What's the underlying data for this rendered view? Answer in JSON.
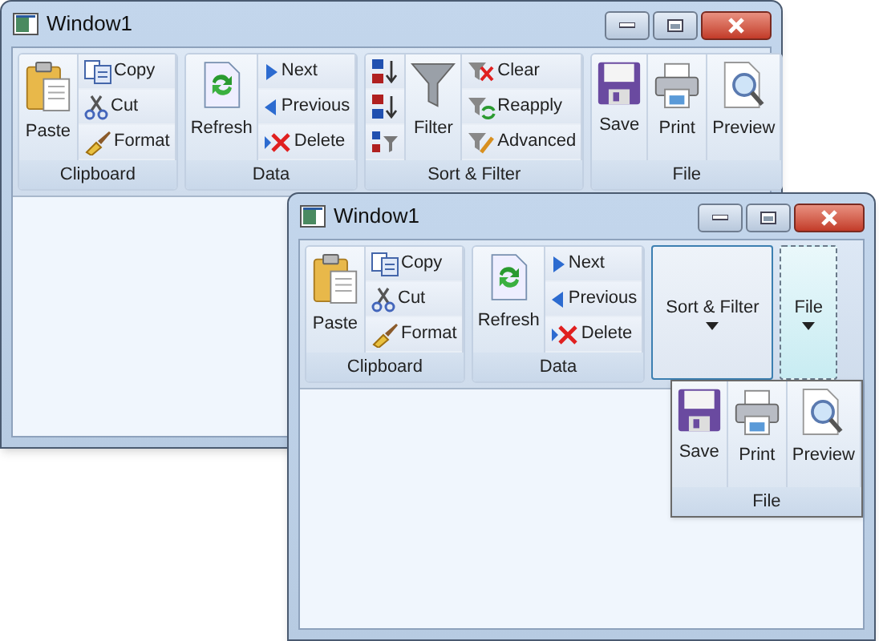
{
  "windows": [
    {
      "title": "Window1",
      "groups": [
        {
          "label": "Clipboard",
          "kind": "expanded",
          "columns": [
            {
              "kind": "large",
              "items": [
                {
                  "label": "Paste"
                }
              ]
            },
            {
              "kind": "small",
              "items": [
                {
                  "label": "Copy"
                },
                {
                  "label": "Cut"
                },
                {
                  "label": "Format"
                }
              ]
            }
          ]
        },
        {
          "label": "Data",
          "kind": "expanded",
          "columns": [
            {
              "kind": "large",
              "items": [
                {
                  "label": "Refresh"
                }
              ]
            },
            {
              "kind": "small",
              "items": [
                {
                  "label": "Next"
                },
                {
                  "label": "Previous"
                },
                {
                  "label": "Delete"
                }
              ]
            }
          ]
        },
        {
          "label": "Sort & Filter",
          "kind": "expanded",
          "columns": [
            {
              "kind": "small",
              "items": [
                {
                  "kind": "icon"
                },
                {
                  "kind": "icon"
                },
                {
                  "kind": "icon"
                }
              ]
            },
            {
              "kind": "large",
              "items": [
                {
                  "label": "Filter"
                }
              ]
            },
            {
              "kind": "small",
              "items": [
                {
                  "label": "Clear"
                },
                {
                  "label": "Reapply"
                },
                {
                  "label": "Advanced"
                }
              ]
            }
          ]
        },
        {
          "label": "File",
          "kind": "expanded",
          "columns": [
            {
              "kind": "large",
              "items": [
                {
                  "label": "Save"
                }
              ]
            },
            {
              "kind": "large",
              "items": [
                {
                  "label": "Print"
                }
              ]
            },
            {
              "kind": "large",
              "items": [
                {
                  "label": "Preview"
                }
              ]
            }
          ]
        }
      ]
    },
    {
      "title": "Window1",
      "groups": [
        {
          "label": "Clipboard",
          "kind": "expanded",
          "columns": [
            {
              "kind": "large",
              "items": [
                {
                  "label": "Paste"
                }
              ]
            },
            {
              "kind": "small",
              "items": [
                {
                  "label": "Copy"
                },
                {
                  "label": "Cut"
                },
                {
                  "label": "Format"
                }
              ]
            }
          ]
        },
        {
          "label": "Data",
          "kind": "expanded",
          "columns": [
            {
              "kind": "large",
              "items": [
                {
                  "label": "Refresh"
                }
              ]
            },
            {
              "kind": "small",
              "items": [
                {
                  "label": "Next"
                },
                {
                  "label": "Previous"
                },
                {
                  "label": "Delete"
                }
              ]
            }
          ]
        },
        {
          "label": "Sort & Filter",
          "kind": "collapsed",
          "selected": false,
          "hovered": true
        },
        {
          "label": "File",
          "kind": "collapsed",
          "selected": true,
          "hovered": false
        }
      ],
      "popup": {
        "label": "File",
        "columns": [
          {
            "kind": "large",
            "items": [
              {
                "label": "Save"
              }
            ]
          },
          {
            "kind": "large",
            "items": [
              {
                "label": "Print"
              }
            ]
          },
          {
            "kind": "large",
            "items": [
              {
                "label": "Preview"
              }
            ]
          }
        ]
      }
    }
  ]
}
